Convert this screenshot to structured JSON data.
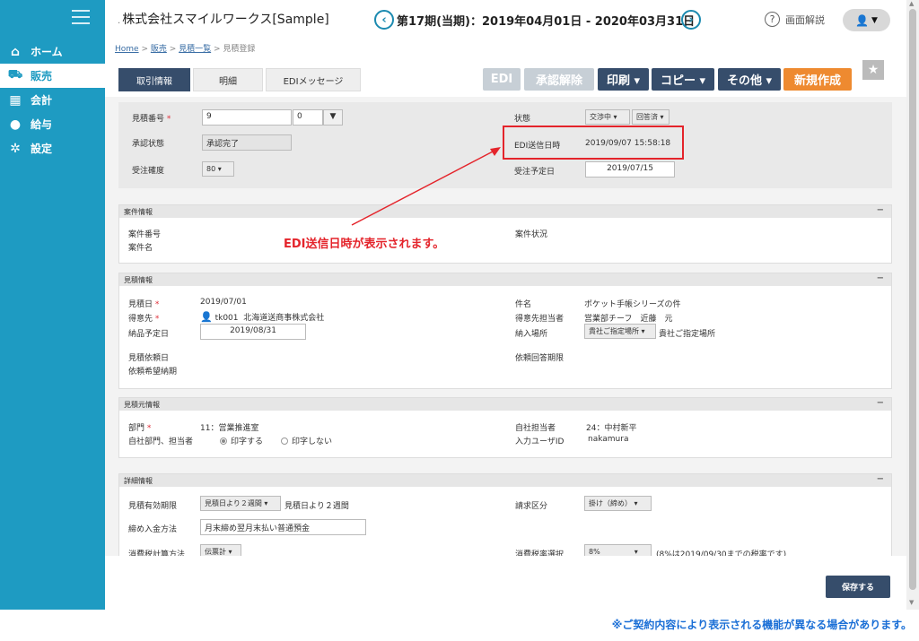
{
  "sidebar": {
    "items": [
      {
        "label": "ホーム",
        "icon": "home-icon",
        "glyph": "⌂"
      },
      {
        "label": "販売",
        "icon": "cart-icon",
        "glyph": "🛒"
      },
      {
        "label": "会計",
        "icon": "calculator-icon",
        "glyph": "▦"
      },
      {
        "label": "給与",
        "icon": "money-bag-icon",
        "glyph": "●"
      },
      {
        "label": "設定",
        "icon": "gear-icon",
        "glyph": "✲"
      }
    ],
    "active": "販売"
  },
  "header": {
    "company": "株式会社スマイルワークス[Sample]",
    "company_prefix": ".",
    "period": "第17期(当期)：2019年04月01日 - 2020年03月31日",
    "help_label": "画面解説",
    "prev_glyph": "‹",
    "next_glyph": "›"
  },
  "breadcrumb": {
    "items": [
      "Home",
      "販売",
      "見積一覧",
      "見積登録"
    ],
    "sep": " > "
  },
  "tabs": [
    {
      "label": "取引情報"
    },
    {
      "label": "明細"
    },
    {
      "label": "EDIメッセージ"
    }
  ],
  "toolbar": {
    "edi": "EDI",
    "approve_cancel": "承認解除",
    "print": "印刷 ▾",
    "copy": "コピー ▾",
    "other": "その他 ▾",
    "new": "新規作成"
  },
  "top": {
    "quote_no_label": "見積番号",
    "quote_no": "9",
    "quote_no_sub": "0",
    "approval_label": "承認状態",
    "approval": "承認完了",
    "accuracy_label": "受注確度",
    "accuracy": "80",
    "status_label": "状態",
    "status1": "交渉中",
    "status2": "回答済",
    "edi_label": "EDI送信日時",
    "edi_value": "2019/09/07 15:58:18",
    "order_date_label": "受注予定日",
    "order_date": "2019/07/15"
  },
  "case": {
    "title": "案件情報",
    "no_label": "案件番号",
    "name_label": "案件名",
    "status_label": "案件状況"
  },
  "quote": {
    "title": "見積情報",
    "date_label": "見積日",
    "date": "2019/07/01",
    "client_label": "得意先",
    "client_code": "tk001",
    "client_name": "北海道送商事株式会社",
    "delivery_label": "納品予定日",
    "delivery": "2019/08/31",
    "req_label": "見積依頼日",
    "req_hope_label": "依頼希望納期",
    "subject_label": "件名",
    "subject": "ポケット手帳シリーズの件",
    "contact_label": "得意先担当者",
    "contact": "営業部チーフ　近藤　元",
    "place_label": "納入場所",
    "place_sel": "貴社ご指定場所",
    "place": "貴社ご指定場所",
    "answer_label": "依頼回答期限"
  },
  "origin": {
    "title": "見積元情報",
    "dept_label": "部門",
    "dept": "11：営業推進室",
    "staff_label": "自社部門、担当者",
    "print_on": "印字する",
    "print_off": "印字しない",
    "own_label": "自社担当者",
    "own": "24：中村新平",
    "user_label": "入力ユーザID",
    "user": "nakamura"
  },
  "detail": {
    "title": "詳細情報",
    "valid_label": "見積有効期限",
    "valid_sel": "見積日より２週間",
    "valid": "見積日より２週間",
    "pay_label": "締め入金方法",
    "pay": "月末締め翌月末払い普通預金",
    "tax_label": "消費税計算方法",
    "tax_sel": "伝票計",
    "bill_label": "請求区分",
    "bill": "掛け（締め）",
    "rate_label": "消費税率選択",
    "rate": "8%",
    "rate_note": "(8%は2019/09/30までの税率です)"
  },
  "callout": "EDI送信日時が表示されます。",
  "save_label": "保存する",
  "notice": "※ご契約内容により表示される機能が異なる場合があります。",
  "colors": {
    "sidebar": "#1e9bc2",
    "navy": "#364d6b",
    "orange": "#ee8a30",
    "callout": "#e4242b",
    "notice": "#1b6fd6"
  }
}
